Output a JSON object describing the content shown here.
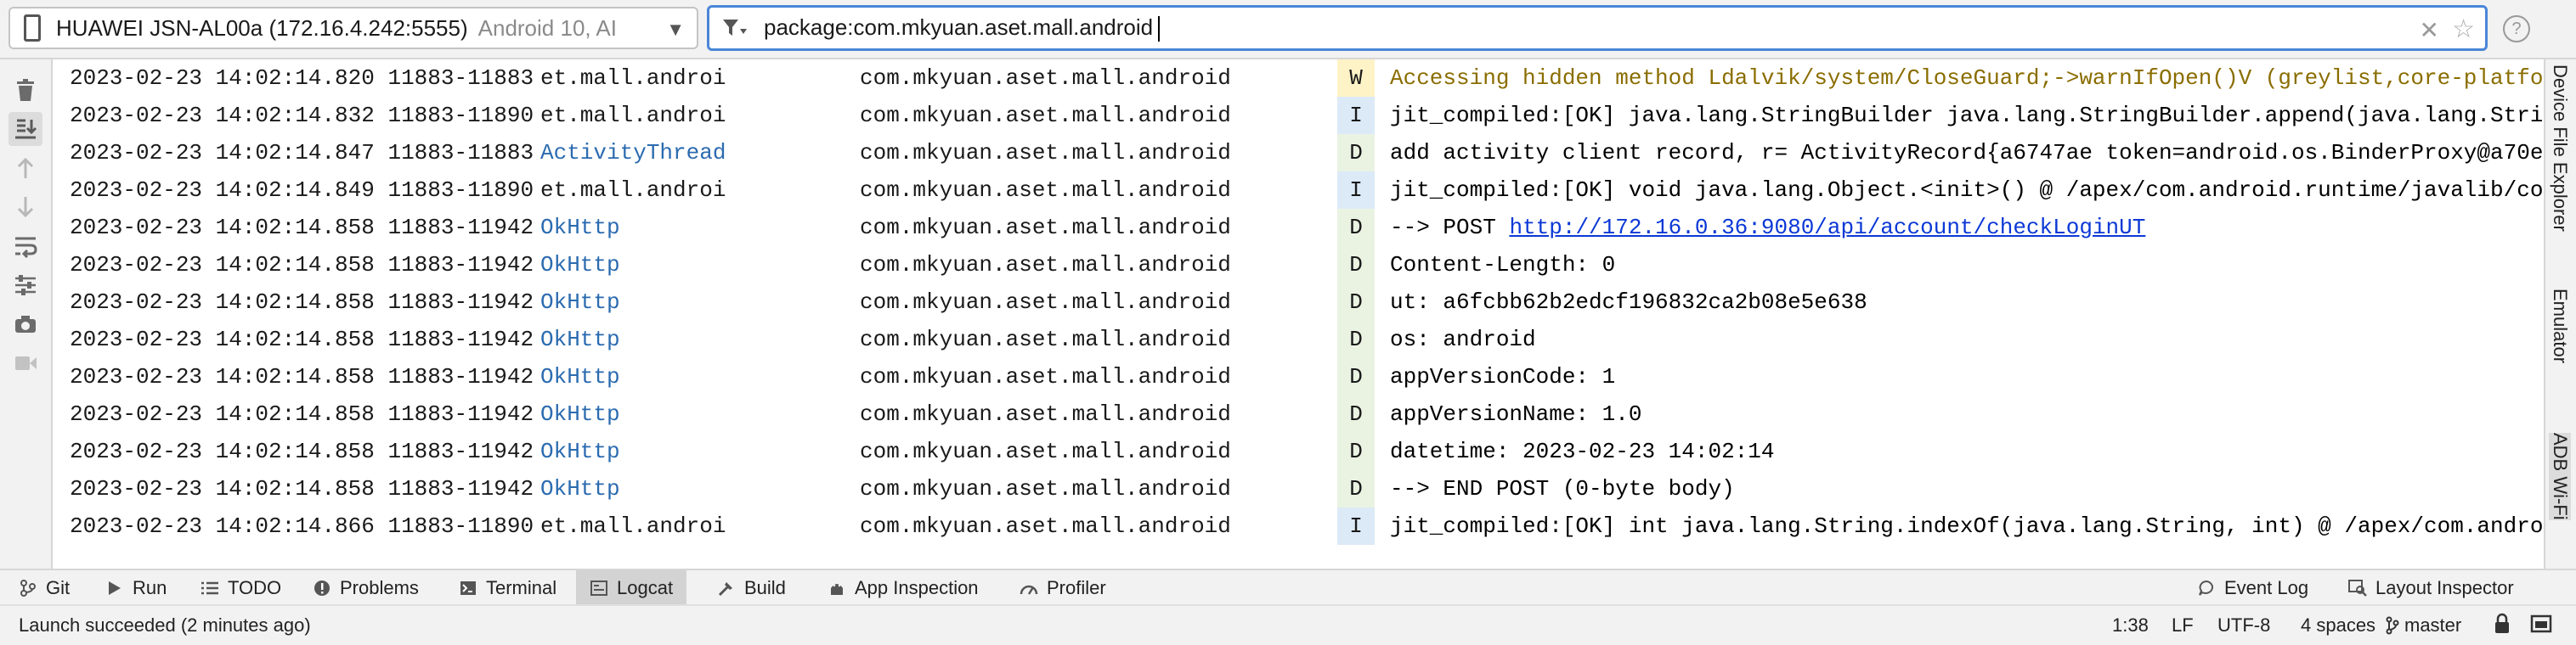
{
  "device": {
    "name": "HUAWEI JSN-AL00a (172.16.4.242:5555)",
    "os": "Android 10, AI"
  },
  "filter": {
    "query": "package:com.mkyuan.aset.mall.android"
  },
  "log_rows": [
    {
      "ts": "2023-02-23 14:02:14.820 11883-11883",
      "tag": "et.mall.androi",
      "pkg": "com.mkyuan.aset.mall.android",
      "level": "W",
      "msg": "Accessing hidden method Ldalvik/system/CloseGuard;->warnIfOpen()V (greylist,core-platfo"
    },
    {
      "ts": "2023-02-23 14:02:14.832 11883-11890",
      "tag": "et.mall.androi",
      "pkg": "com.mkyuan.aset.mall.android",
      "level": "I",
      "msg": "jit_compiled:[OK] java.lang.StringBuilder java.lang.StringBuilder.append(java.lang.Stri"
    },
    {
      "ts": "2023-02-23 14:02:14.847 11883-11883",
      "tag": "ActivityThread",
      "pkg": "com.mkyuan.aset.mall.android",
      "level": "D",
      "msg": "add activity client record, r= ActivityRecord{a6747ae token=android.os.BinderProxy@a70e"
    },
    {
      "ts": "2023-02-23 14:02:14.849 11883-11890",
      "tag": "et.mall.androi",
      "pkg": "com.mkyuan.aset.mall.android",
      "level": "I",
      "msg": "jit_compiled:[OK] void java.lang.Object.<init>() @ /apex/com.android.runtime/javalib/co"
    },
    {
      "ts": "2023-02-23 14:02:14.858 11883-11942",
      "tag": "OkHttp",
      "pkg": "com.mkyuan.aset.mall.android",
      "level": "D",
      "msg": "--> POST ",
      "link": "http://172.16.0.36:9080/api/account/checkLoginUT"
    },
    {
      "ts": "2023-02-23 14:02:14.858 11883-11942",
      "tag": "OkHttp",
      "pkg": "com.mkyuan.aset.mall.android",
      "level": "D",
      "msg": "Content-Length: 0"
    },
    {
      "ts": "2023-02-23 14:02:14.858 11883-11942",
      "tag": "OkHttp",
      "pkg": "com.mkyuan.aset.mall.android",
      "level": "D",
      "msg": "ut: a6fcbb62b2edcf196832ca2b08e5e638"
    },
    {
      "ts": "2023-02-23 14:02:14.858 11883-11942",
      "tag": "OkHttp",
      "pkg": "com.mkyuan.aset.mall.android",
      "level": "D",
      "msg": "os: android"
    },
    {
      "ts": "2023-02-23 14:02:14.858 11883-11942",
      "tag": "OkHttp",
      "pkg": "com.mkyuan.aset.mall.android",
      "level": "D",
      "msg": "appVersionCode: 1"
    },
    {
      "ts": "2023-02-23 14:02:14.858 11883-11942",
      "tag": "OkHttp",
      "pkg": "com.mkyuan.aset.mall.android",
      "level": "D",
      "msg": "appVersionName: 1.0"
    },
    {
      "ts": "2023-02-23 14:02:14.858 11883-11942",
      "tag": "OkHttp",
      "pkg": "com.mkyuan.aset.mall.android",
      "level": "D",
      "msg": "datetime: 2023-02-23 14:02:14"
    },
    {
      "ts": "2023-02-23 14:02:14.858 11883-11942",
      "tag": "OkHttp",
      "pkg": "com.mkyuan.aset.mall.android",
      "level": "D",
      "msg": "--> END POST (0-byte body)"
    },
    {
      "ts": "2023-02-23 14:02:14.866 11883-11890",
      "tag": "et.mall.androi",
      "pkg": "com.mkyuan.aset.mall.android",
      "level": "I",
      "msg": "jit_compiled:[OK] int java.lang.String.indexOf(java.lang.String, int) @ /apex/com.andro"
    }
  ],
  "right_tabs": [
    "Device File Explorer",
    "Emulator",
    "ADB Wi-Fi"
  ],
  "bottom_tabs": {
    "git": "Git",
    "run": "Run",
    "todo": "TODO",
    "problems": "Problems",
    "terminal": "Terminal",
    "logcat": "Logcat",
    "build": "Build",
    "app_inspection": "App Inspection",
    "profiler": "Profiler",
    "event_log": "Event Log",
    "layout_inspector": "Layout Inspector"
  },
  "status": {
    "message": "Launch succeeded (2 minutes ago)",
    "position": "1:38",
    "line_sep": "LF",
    "encoding": "UTF-8",
    "indent": "4 spaces",
    "branch": "master"
  },
  "colors": {
    "accent": "#4a86d8",
    "warn_bg": "#fdf3c7",
    "info_bg": "#dceaf8",
    "debug_bg": "#eaf3e2",
    "link": "#0b38d6",
    "class_tag": "#2b6bb0"
  },
  "icons": [
    "phone-icon",
    "chevron-down-icon",
    "filter-icon",
    "clear-icon",
    "star-icon",
    "help-icon",
    "trash-icon",
    "scroll-to-end-icon",
    "up-arrow-icon",
    "down-arrow-icon",
    "soft-wrap-icon",
    "settings-icon",
    "camera-icon",
    "video-icon",
    "git-icon",
    "run-icon",
    "todo-icon",
    "problems-icon",
    "terminal-icon",
    "logcat-icon",
    "build-icon",
    "app-inspection-icon",
    "profiler-icon",
    "event-log-icon",
    "layout-inspector-icon",
    "branch-icon",
    "lock-icon"
  ]
}
